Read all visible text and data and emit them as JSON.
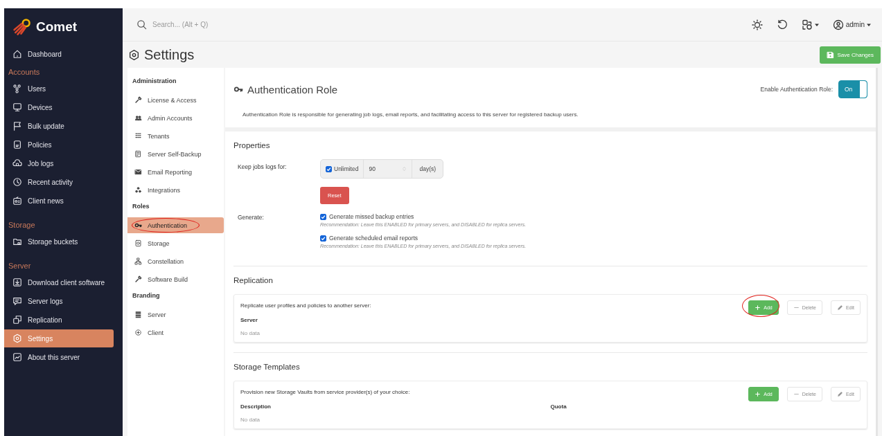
{
  "brand": {
    "name": "Comet"
  },
  "sidebar": {
    "items": [
      {
        "kind": "item",
        "label": "Dashboard",
        "selected": false
      },
      {
        "kind": "heading",
        "label": "Accounts"
      },
      {
        "kind": "item",
        "label": "Users",
        "selected": false
      },
      {
        "kind": "item",
        "label": "Devices",
        "selected": false
      },
      {
        "kind": "item",
        "label": "Bulk update",
        "selected": false
      },
      {
        "kind": "item",
        "label": "Policies",
        "selected": false
      },
      {
        "kind": "item",
        "label": "Job logs",
        "selected": false
      },
      {
        "kind": "item",
        "label": "Recent activity",
        "selected": false
      },
      {
        "kind": "item",
        "label": "Client news",
        "selected": false
      },
      {
        "kind": "heading",
        "label": "Storage"
      },
      {
        "kind": "item",
        "label": "Storage buckets",
        "selected": false
      },
      {
        "kind": "heading",
        "label": "Server"
      },
      {
        "kind": "item",
        "label": "Download client software",
        "selected": false
      },
      {
        "kind": "item",
        "label": "Server logs",
        "selected": false
      },
      {
        "kind": "item",
        "label": "Replication",
        "selected": false
      },
      {
        "kind": "item",
        "label": "Settings",
        "selected": true
      },
      {
        "kind": "item",
        "label": "About this server",
        "selected": false
      }
    ]
  },
  "topbar": {
    "search": {
      "placeholder": "Search... (Alt + Q)"
    },
    "user": "admin"
  },
  "header": {
    "title": "Settings",
    "save_button": "Save Changes"
  },
  "settings_nav": {
    "groups": [
      {
        "heading": "Administration",
        "items": [
          {
            "label": "License & Access",
            "selected": false,
            "annotated": false
          },
          {
            "label": "Admin Accounts",
            "selected": false,
            "annotated": false
          },
          {
            "label": "Tenants",
            "selected": false,
            "annotated": false
          },
          {
            "label": "Server Self-Backup",
            "selected": false,
            "annotated": false
          },
          {
            "label": "Email Reporting",
            "selected": false,
            "annotated": false
          },
          {
            "label": "Integrations",
            "selected": false,
            "annotated": false
          }
        ]
      },
      {
        "heading": "Roles",
        "items": [
          {
            "label": "Authentication",
            "selected": true,
            "annotated": true
          },
          {
            "label": "Storage",
            "selected": false,
            "annotated": false
          },
          {
            "label": "Constellation",
            "selected": false,
            "annotated": false
          },
          {
            "label": "Software Build",
            "selected": false,
            "annotated": false
          }
        ]
      },
      {
        "heading": "Branding",
        "items": [
          {
            "label": "Server",
            "selected": false,
            "annotated": false
          },
          {
            "label": "Client",
            "selected": false,
            "annotated": false
          }
        ]
      }
    ]
  },
  "role": {
    "title": "Authentication Role",
    "description": "Authentication Role is responsible for generating job logs, email reports, and facilitating access to this server for registered backup users.",
    "toggle_label": "Enable Authentication Role:",
    "toggle": {
      "on": true,
      "label": "On"
    }
  },
  "properties": {
    "title": "Properties",
    "keep_logs": {
      "label": "Keep jobs logs for:",
      "unlimited": {
        "label": "Unlimited",
        "checked": true
      },
      "value": "90",
      "unit": "day(s)",
      "reset_button": "Reset"
    },
    "generate": {
      "label": "Generate:",
      "options": [
        {
          "label": "Generate missed backup entries",
          "checked": true,
          "hint": "Recommendation: Leave this ENABLED for primary servers, and DISABLED for replica servers."
        },
        {
          "label": "Generate scheduled email reports",
          "checked": true,
          "hint": "Recommendation: Leave this ENABLED for primary servers, and DISABLED for replica servers."
        }
      ]
    }
  },
  "sections": [
    {
      "title": "Replication",
      "caption": "Replicate user profiles and policies to another server:",
      "buttons": [
        {
          "kind": "add",
          "label": "Add",
          "disabled": false,
          "annotated": true
        },
        {
          "kind": "delete",
          "label": "Delete",
          "disabled": true,
          "annotated": false
        },
        {
          "kind": "edit",
          "label": "Edit",
          "disabled": true,
          "annotated": false
        }
      ],
      "columns": [
        "Server"
      ],
      "empty": "No data"
    },
    {
      "title": "Storage Templates",
      "caption": "Provision new Storage Vaults from service provider(s) of your choice:",
      "buttons": [
        {
          "kind": "add",
          "label": "Add",
          "disabled": false,
          "annotated": false
        },
        {
          "kind": "delete",
          "label": "Delete",
          "disabled": true,
          "annotated": false
        },
        {
          "kind": "edit",
          "label": "Edit",
          "disabled": true,
          "annotated": false
        }
      ],
      "columns": [
        "Description",
        "Quota"
      ],
      "empty": "No data"
    }
  ]
}
